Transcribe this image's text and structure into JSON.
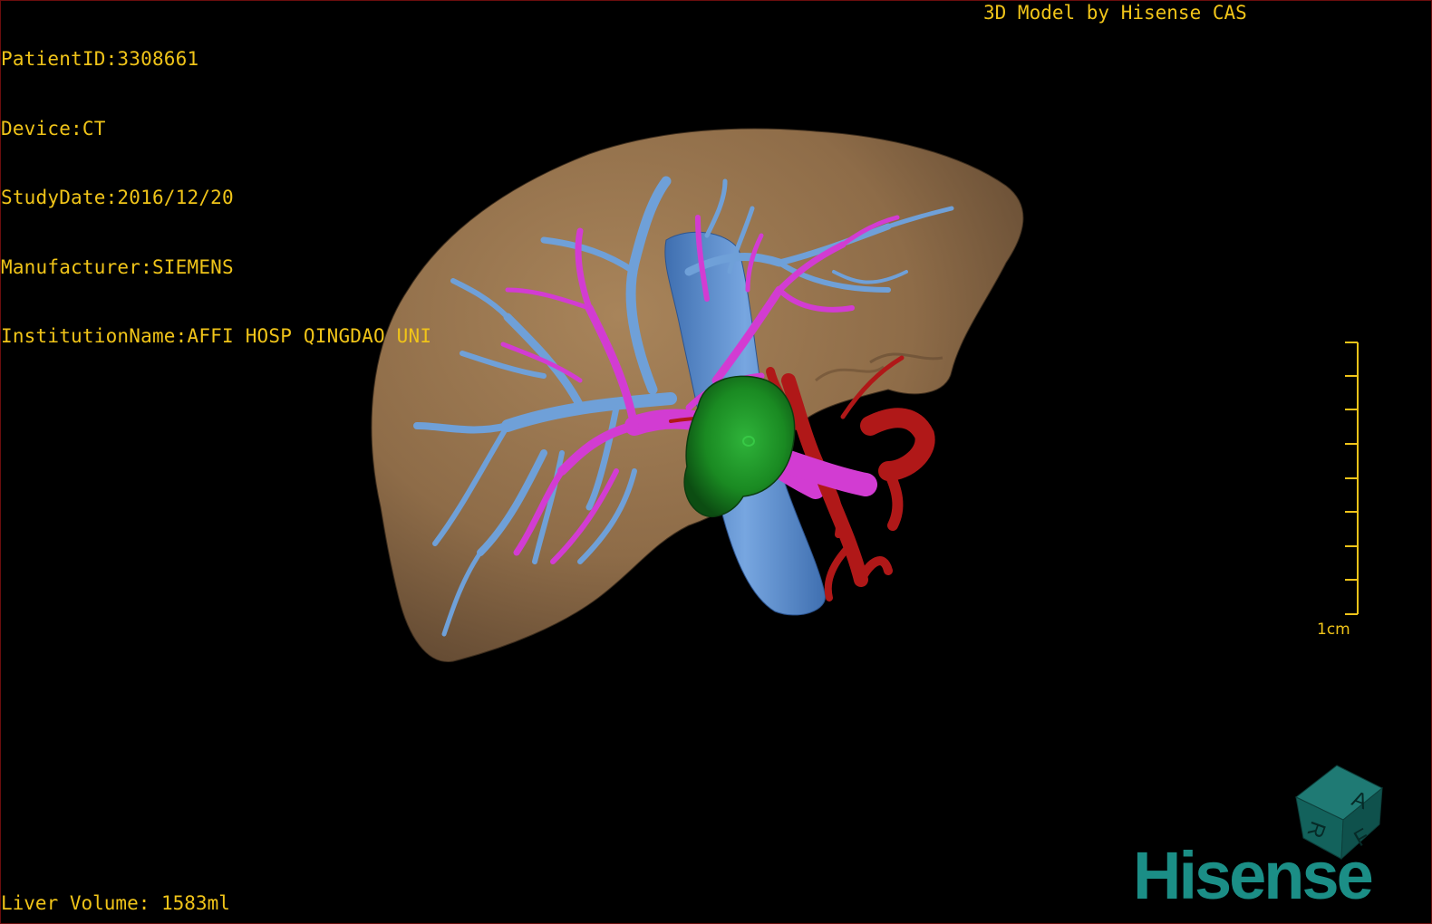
{
  "overlay": {
    "patient_id": "PatientID:3308661",
    "device": "Device:CT",
    "study_date": "StudyDate:2016/12/20",
    "manufacturer": "Manufacturer:SIEMENS",
    "institution": "InstitutionName:AFFI HOSP QINGDAO UNI",
    "title": "3D Model by Hisense CAS",
    "liver_volume": "Liver Volume: 1583ml"
  },
  "scale_bar": {
    "label": "1cm"
  },
  "orientation_cube": {
    "faces": [
      "A",
      "R",
      "F"
    ]
  },
  "brand": {
    "logo_text": "Hisense"
  },
  "colors": {
    "text": "#f0c419",
    "liver": "#9c7a54",
    "portal_vein": "#6fa0d8",
    "hepatic_vein": "#d23cd2",
    "artery": "#b01818",
    "tumor": "#1f8f2a",
    "brand": "#1b8e86"
  }
}
